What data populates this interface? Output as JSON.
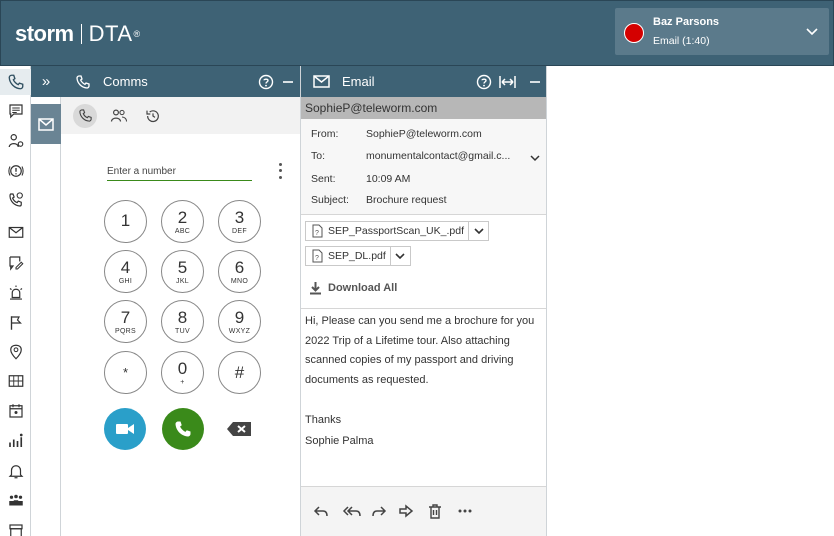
{
  "header": {
    "logo_storm": "storm",
    "logo_dta": "DTA",
    "logo_reg": "®",
    "user_name": "Baz Parsons",
    "user_status": "Email  (1:40)",
    "status_color": "#d40000"
  },
  "nav": {
    "icons": [
      "phone-icon",
      "chat-icon",
      "contact-settings-icon",
      "alert-icon",
      "call-history-icon",
      "mail-icon",
      "edit-note-icon",
      "alarm-icon",
      "flag-icon",
      "location-icon",
      "gallery-icon",
      "calendar-icon",
      "people-chart-icon",
      "bell-icon",
      "group-icon",
      "archive-icon"
    ]
  },
  "rail": {
    "expand_label": "»"
  },
  "comms": {
    "title": "Comms",
    "number_placeholder": "Enter a number",
    "keys": [
      {
        "digit": "1",
        "letters": ""
      },
      {
        "digit": "2",
        "letters": "ABC"
      },
      {
        "digit": "3",
        "letters": "DEF"
      },
      {
        "digit": "4",
        "letters": "GHI"
      },
      {
        "digit": "5",
        "letters": "JKL"
      },
      {
        "digit": "6",
        "letters": "MNO"
      },
      {
        "digit": "7",
        "letters": "PQRS"
      },
      {
        "digit": "8",
        "letters": "TUV"
      },
      {
        "digit": "9",
        "letters": "WXYZ"
      },
      {
        "digit": "*",
        "letters": ""
      },
      {
        "digit": "0",
        "letters": "+"
      },
      {
        "digit": "#",
        "letters": ""
      }
    ],
    "video_color": "#2a9fc9",
    "call_color": "#3a8a1a"
  },
  "email": {
    "title": "Email",
    "address_bar": "SophieP@teleworm.com",
    "from_label": "From:",
    "from_value": "SophieP@teleworm.com",
    "to_label": "To:",
    "to_value": "monumentalcontact@gmail.c...",
    "sent_label": "Sent:",
    "sent_value": "10:09 AM",
    "subject_label": "Subject:",
    "subject_value": "Brochure request",
    "attachments": [
      "SEP_PassportScan_UK_.pdf",
      "SEP_DL.pdf"
    ],
    "download_all": "Download All",
    "body": "Hi, Please can you send me a brochure for you 2022 Trip of a Lifetime tour. Also attaching scanned copies of my passport and driving documents as requested.",
    "signoff": "Thanks",
    "signature": "Sophie Palma"
  }
}
